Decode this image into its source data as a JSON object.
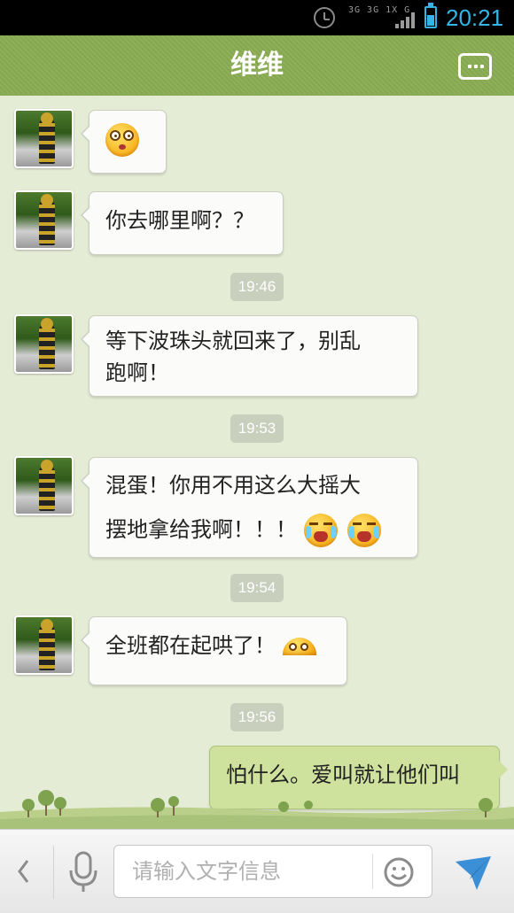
{
  "status_bar": {
    "time": "20:21",
    "network": "3G 3G 1X G",
    "icons": [
      "alarm-clock-icon",
      "network-type-icon",
      "signal-icon",
      "battery-icon"
    ],
    "accent_color": "#33b5e5"
  },
  "header": {
    "title": "维维",
    "more_icon": "more-options-icon",
    "background_color": "#8aab55"
  },
  "messages": [
    {
      "direction": "in",
      "text": "",
      "emojis": [
        "dizzy-emoji"
      ]
    },
    {
      "direction": "in",
      "text": "你去哪里啊？？",
      "emojis": []
    },
    {
      "type": "timestamp",
      "text": "19:46"
    },
    {
      "direction": "in",
      "text_line1": "等下波珠头就回来了，别乱",
      "text_line2": "跑啊！"
    },
    {
      "type": "timestamp",
      "text": "19:53"
    },
    {
      "direction": "in",
      "text_line1": "混蛋！你用不用这么大摇大",
      "text_line2": "摆地拿给我啊！！！",
      "emojis": [
        "crying-emoji",
        "crying-emoji"
      ]
    },
    {
      "type": "timestamp",
      "text": "19:54"
    },
    {
      "direction": "in",
      "text": "全班都在起哄了！",
      "emojis": [
        "peeking-emoji"
      ]
    },
    {
      "type": "timestamp",
      "text": "19:56"
    },
    {
      "direction": "out",
      "text": "怕什么。爱叫就让他们叫"
    }
  ],
  "input_bar": {
    "placeholder": "请输入文字信息",
    "icons": [
      "back-arrow-icon",
      "microphone-icon",
      "smiley-icon",
      "send-icon"
    ]
  },
  "colors": {
    "chat_background": "#e5ecd6",
    "incoming_bubble": "#fbfbfa",
    "outgoing_bubble": "#cfe29d",
    "timestamp_pill": "#c9cfbd"
  }
}
